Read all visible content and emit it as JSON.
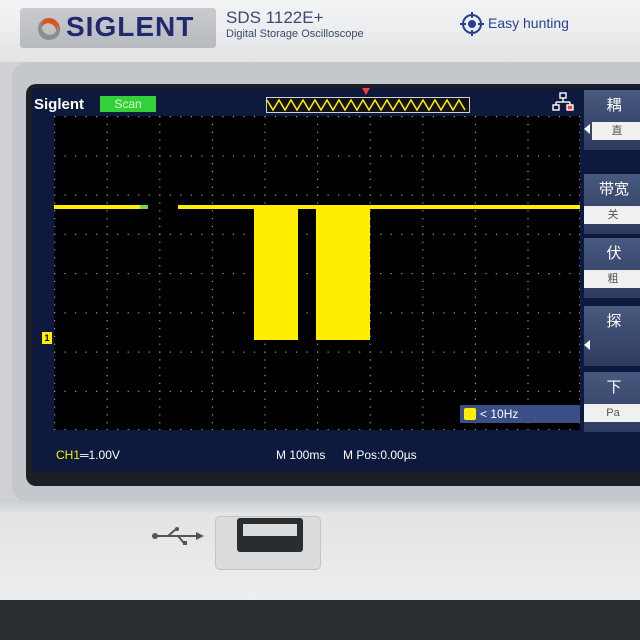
{
  "device": {
    "brand": "SIGLENT",
    "model": "SDS 1122E+",
    "model_subtitle": "Digital Storage Oscilloscope",
    "easy_label": "Easy hunting"
  },
  "screen": {
    "brand_label": "Siglent",
    "run_state": "Scan",
    "ch_label": "CH1",
    "ch_scale": "1.00V",
    "timebase": "M 100ms",
    "mpos": "M Pos:0.00µs",
    "freq_readout": "< 10Hz",
    "channel_marker": "1"
  },
  "menu": {
    "items": [
      {
        "head": "耦",
        "value": "直"
      },
      {
        "head": "带宽",
        "value": "关"
      },
      {
        "head": "伏",
        "value": "粗"
      },
      {
        "head": "探",
        "value": ""
      },
      {
        "head": "下",
        "value": "Pa"
      }
    ]
  },
  "colors": {
    "trace": "#ffee00",
    "grid_dot": "#9aa0aa",
    "lcd_bg": "#0e1a3d"
  },
  "icons": {
    "usb": "usb-icon",
    "network": "network-icon",
    "easy": "crosshair-icon"
  }
}
